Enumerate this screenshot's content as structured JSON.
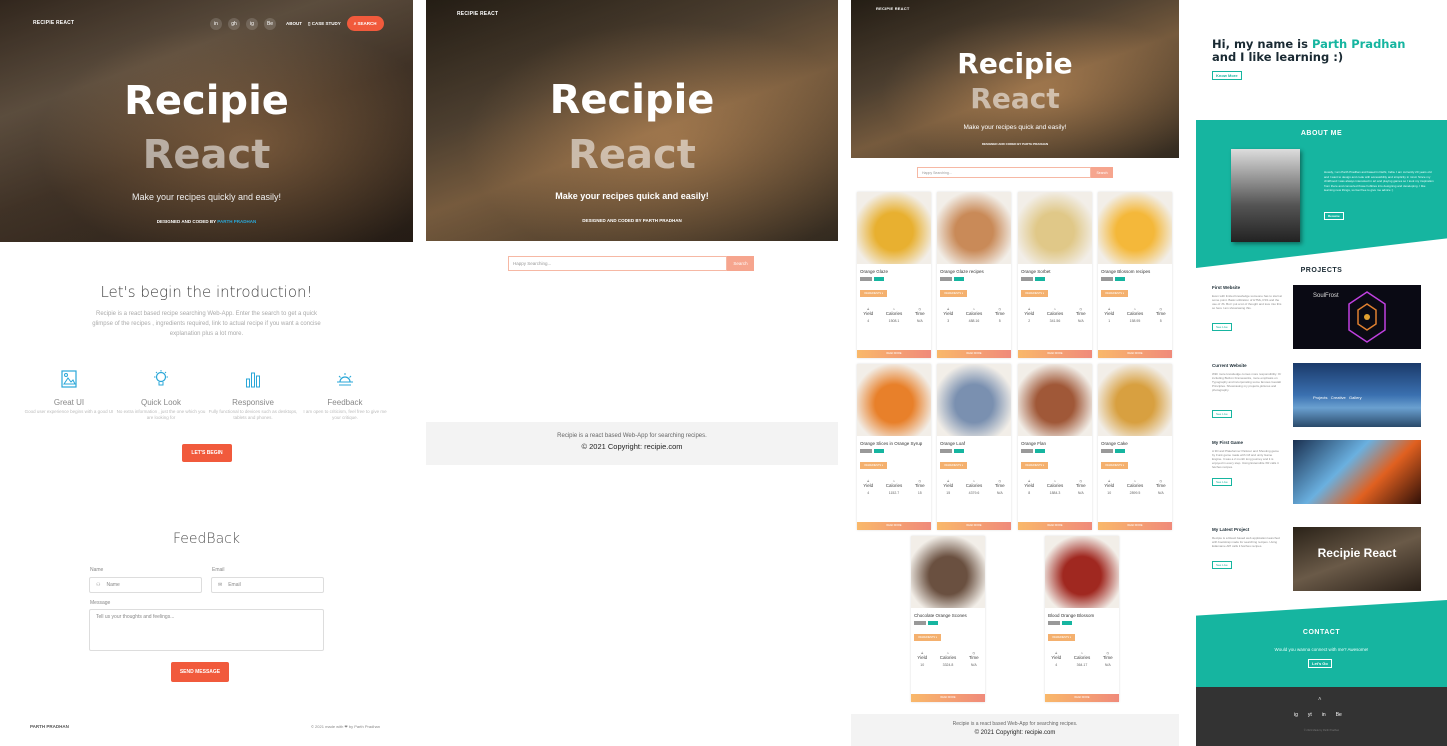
{
  "panel1": {
    "brand": "RECIPIE REACT",
    "nav": {
      "icons": [
        "in",
        "gh",
        "ig",
        "Be"
      ],
      "about": "ABOUT",
      "case_study": "CASE STUDY",
      "search": "SEARCH"
    },
    "hero": {
      "title1": "Recipie",
      "title2": "React",
      "subtitle": "Make your recipes quickly and easily!",
      "credit_prefix": "DESIGNED AND CODED BY",
      "credit_name": "PARTH PRADHAN"
    },
    "intro": {
      "title": "Let's begin the introduction!",
      "text": "Recipie is a react based recipe searching Web-App. Enter the search to get a quick glimpse of the recipes , ingredients required, link to actual recipe if you want a concise explanation plus a lot more.",
      "features": [
        {
          "title": "Great UI",
          "desc": "Good user experience begins with a good UI",
          "icon": "picture-icon"
        },
        {
          "title": "Quick Look",
          "desc": "No extra information , just the one which you are looking for",
          "icon": "bulb-icon"
        },
        {
          "title": "Responsive",
          "desc": "Fully functional to devices such as desktops, tablets and phones.",
          "icon": "bar-chart-icon"
        },
        {
          "title": "Feedback",
          "desc": "I am open to criticism, feel free to give me your critique.",
          "icon": "sunrise-icon"
        }
      ],
      "cta": "LET'S BEGIN"
    },
    "feedback": {
      "title": "FeedBack",
      "name_label": "Name",
      "name_placeholder": "Name",
      "email_label": "Email",
      "email_placeholder": "Email",
      "message_label": "Message",
      "message_placeholder": "Tell us your thoughts and feelings...",
      "send": "SEND MESSAGE"
    },
    "footer": {
      "left": "PARTH PRADHAN",
      "right": "© 2021 made with ❤ by Parth Pradhan"
    }
  },
  "panel2": {
    "brand": "RECIPIE REACT",
    "title1": "Recipie",
    "title2": "React",
    "subtitle": "Make your recipes quick and easily!",
    "credit": "DESIGNED AND CODED BY PARTH PRADHAN",
    "search_placeholder": "Happy Searching...",
    "search_button": "Search",
    "footer_text": "Recipie is a react based Web-App for searching recipes.",
    "copyright": "© 2021 Copyright: recipie.com"
  },
  "panel3": {
    "brand": "RECIPIE REACT",
    "title1": "Recipie",
    "title2": "React",
    "subtitle": "Make your recipes quick and easily!",
    "credit": "DESIGNED AND CODED BY PARTH PRADHAN",
    "search_placeholder": "Happy Searching...",
    "search_button": "Search",
    "ingredients_label": "INGREDIENTS ▾",
    "read_more": "READ MORE",
    "stat_labels": [
      "Yield",
      "Calories",
      "Time"
    ],
    "cards": [
      {
        "name": "Orange Glaze",
        "yield": "4",
        "cal": "1508.1",
        "time": "N/A",
        "img": "#e8b030"
      },
      {
        "name": "Orange Glaze recipes",
        "yield": "3",
        "cal": "488.16",
        "time": "5",
        "img": "#c98a58"
      },
      {
        "name": "Orange Sorbet",
        "yield": "2",
        "cal": "341.56",
        "time": "N/A",
        "img": "#e0c888"
      },
      {
        "name": "Orange Blossom recipes",
        "yield": "1",
        "cal": "158.95",
        "time": "5",
        "img": "#f4b83a"
      },
      {
        "name": "Orange Slices in Orange Syrup",
        "yield": "4",
        "cal": "1152.7",
        "time": "15",
        "img": "#e8802a"
      },
      {
        "name": "Orange Loaf",
        "yield": "15",
        "cal": "4379.6",
        "time": "N/A",
        "img": "#7a90b0"
      },
      {
        "name": "Orange Flan",
        "yield": "8",
        "cal": "1884.3",
        "time": "N/A",
        "img": "#a05838"
      },
      {
        "name": "Orange Cake",
        "yield": "10",
        "cal": "2899.5",
        "time": "N/A",
        "img": "#d8a040"
      },
      {
        "name": "Chocolate Orange Scones",
        "yield": "10",
        "cal": "3324.8",
        "time": "N/A",
        "img": "#6a5040"
      },
      {
        "name": "Blood Orange Blossom",
        "yield": "4",
        "cal": "364.17",
        "time": "N/A",
        "img": "#a02820"
      }
    ],
    "footer_text": "Recipie is a react based Web-App for searching recipes.",
    "copyright": "© 2021 Copyright: recipie.com"
  },
  "panel4": {
    "greeting": "Hi, my name is",
    "name": "Parth Pradhan",
    "tagline": "and I like learning :)",
    "know_more": "Know More",
    "about_title": "ABOUT ME",
    "about_text": "Howdy, I am Parth Pradhan and based in Delhi, India. I am currently 20 years old and I want to design and code with accessibility and simplicity in mind. Since my childhood I was always interested in art and playing games so I took my inspiration from there and converted those hobbies into designing and developing. I like learning new things, so feel free to give me advice :)",
    "resume": "Resume",
    "projects_title": "PROJECTS",
    "projects": [
      {
        "title": "First Website",
        "desc": "Even with limited knowledge someone has to start at some point. Basic utilization of HTML,CSS and the use of JS. But I put a lot of thought and love into this so here I am showcasing this.",
        "btn": "See Live",
        "img_text": "SoulFrost"
      },
      {
        "title": "Current Website",
        "desc": "With more knowledge comes more responsibility. Or including Built-in Frameworks, more emphasis on Typography and incorporating some famous Gestalt Principles. Showcasing my projects,pictures and photography.",
        "btn": "See Live",
        "img_text": "Projects   Creative   Gallery"
      },
      {
        "title": "My First Game",
        "desc": "A 3D and Plateformer Parkour and Shooting game by Funk game made with C# and unity Game Engine. It was a 2 month long journey and it is enjoyed in every step. Using Extensible XR calls it fetches recipes.",
        "btn": "See Live",
        "img_text": ""
      },
      {
        "title": "My Latest Project",
        "desc": "Recipie is a React based web application launched with bootstrap made for searching recipes. Using Edamame API calls it fetches recipes.",
        "btn": "See Live",
        "img_text": "Recipie React"
      }
    ],
    "contact_title": "CONTACT",
    "contact_text": "Would you wanna connect with me? Awesome!",
    "contact_btn": "Let's Go",
    "socials": [
      "ig",
      "yt",
      "in",
      "Be"
    ],
    "footer_copy": "© 2021 Made by Parth Pradhan"
  }
}
